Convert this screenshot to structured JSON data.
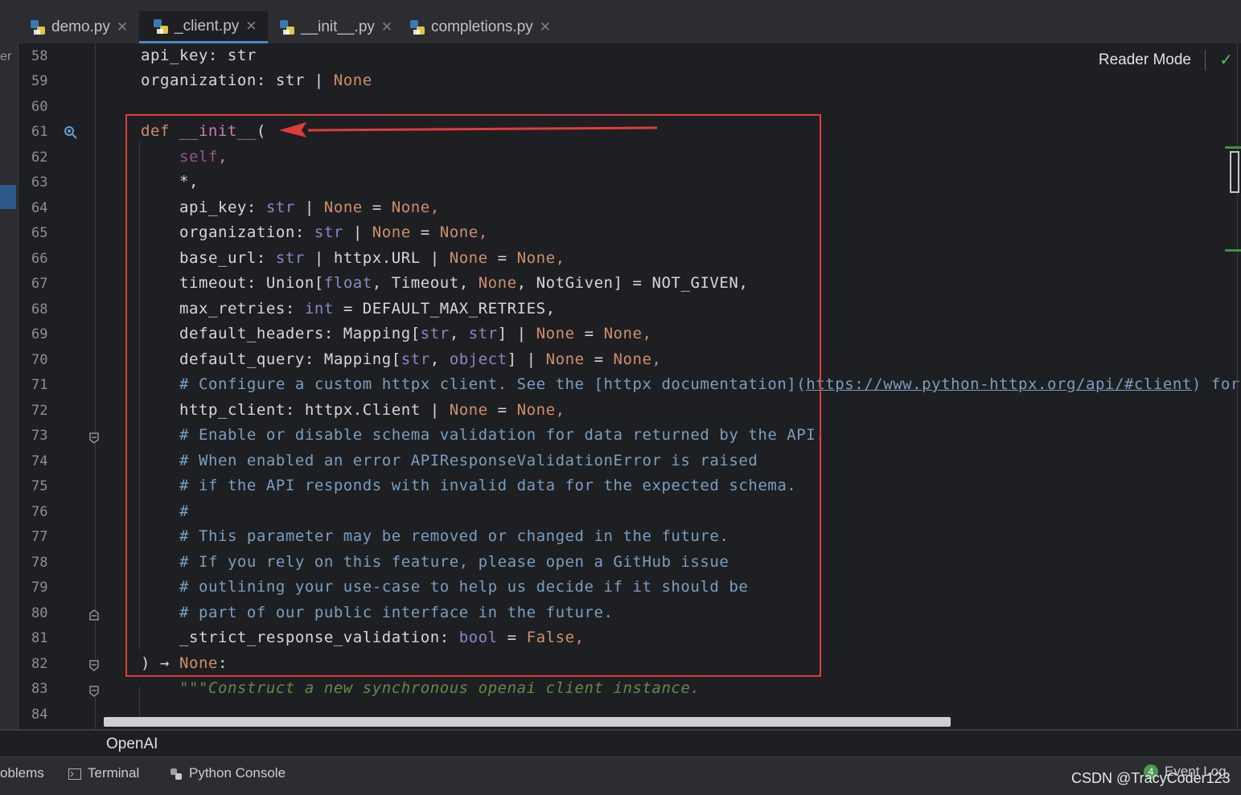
{
  "tabs": [
    {
      "label": "demo.py",
      "active": false
    },
    {
      "label": "_client.py",
      "active": true
    },
    {
      "label": "__init__.py",
      "active": false
    },
    {
      "label": "completions.py",
      "active": false
    }
  ],
  "left_rail_text": "er",
  "reader_mode_label": "Reader Mode",
  "lines": [
    {
      "n": "58"
    },
    {
      "n": "59"
    },
    {
      "n": "60"
    },
    {
      "n": "61"
    },
    {
      "n": "62"
    },
    {
      "n": "63"
    },
    {
      "n": "64"
    },
    {
      "n": "65"
    },
    {
      "n": "66"
    },
    {
      "n": "67"
    },
    {
      "n": "68"
    },
    {
      "n": "69"
    },
    {
      "n": "70"
    },
    {
      "n": "71"
    },
    {
      "n": "72"
    },
    {
      "n": "73"
    },
    {
      "n": "74"
    },
    {
      "n": "75"
    },
    {
      "n": "76"
    },
    {
      "n": "77"
    },
    {
      "n": "78"
    },
    {
      "n": "79"
    },
    {
      "n": "80"
    },
    {
      "n": "81"
    },
    {
      "n": "82"
    },
    {
      "n": "83"
    },
    {
      "n": "84"
    }
  ],
  "code": {
    "l58": "api_key: str",
    "l59a": "organization: str | ",
    "none": "None",
    "def": "def",
    "init": "__init__",
    "paren_open": "(",
    "self": "self",
    "comma": ",",
    "star": "*,",
    "l64a": "api_key: ",
    "str": "str",
    "bar": " | ",
    "eq": " = ",
    "l65a": "organization: ",
    "l66a": "base_url: ",
    "l66b": "httpx.URL",
    "l67a": "timeout: Union[",
    "float": "float",
    "l67b": ", Timeout, ",
    "l67c": ", NotGiven] = NOT_GIVEN,",
    "l68a": "max_retries: ",
    "int": "int",
    "l68b": " = DEFAULT_MAX_RETRIES,",
    "l69a": "default_headers: Mapping[",
    "l69b": ", ",
    "l69c": "] | ",
    "l70a": "default_query: Mapping[",
    "object": "object",
    "l71a": "# Configure a custom httpx client. See the [httpx documentation](",
    "l71link": "https://www.python-httpx.org/api/#client",
    "l71b": ") for",
    "l72a": "http_client: httpx.Client | ",
    "c73": "# Enable or disable schema validation for data returned by the API.",
    "c74": "# When enabled an error APIResponseValidationError is raised",
    "c75": "# if the API responds with invalid data for the expected schema.",
    "c76": "#",
    "c77": "# This parameter may be removed or changed in the future.",
    "c78": "# If you rely on this feature, please open a GitHub issue",
    "c79": "# outlining your use-case to help us decide if it should be",
    "c80": "# part of our public interface in the future.",
    "l81a": "_strict_response_validation: ",
    "bool": "bool",
    "false": "False",
    "l82a": ") → ",
    "colon": ":",
    "doc83": "\"\"\"Construct a new synchronous openai client instance."
  },
  "breadcrumb": "OpenAI",
  "toolbar": {
    "problems": "oblems",
    "terminal": "Terminal",
    "python_console": "Python Console",
    "event_log": "Event Log",
    "event_count": "4"
  },
  "watermark": "CSDN @TracyCoder123",
  "colors": {
    "highlight_box": "#e03c3c",
    "keyword": "#cf8e6d",
    "comment": "#7a9ec2",
    "docstring": "#5f8c4a",
    "builtin": "#8888c6"
  }
}
